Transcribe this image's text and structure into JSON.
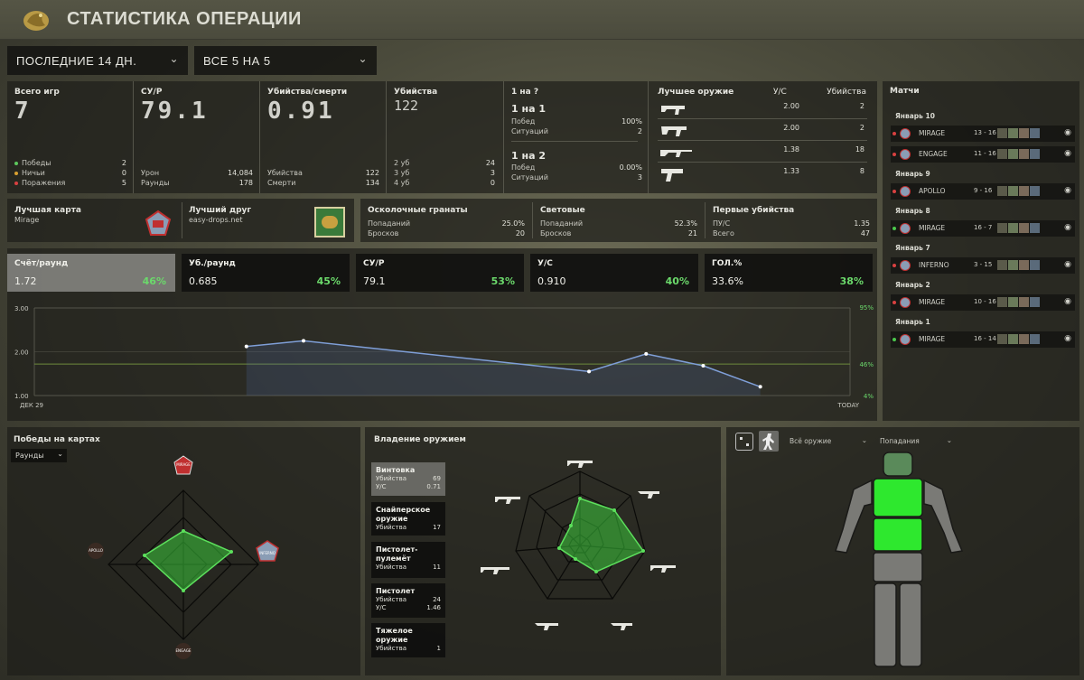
{
  "header": {
    "title": "СТАТИСТИКА ОПЕРАЦИИ"
  },
  "filters": {
    "period": "ПОСЛЕДНИЕ 14 ДН.",
    "mode": "ВСЕ 5 НА 5"
  },
  "summary": {
    "games": {
      "label": "Всего игр",
      "value": "7",
      "wins_label": "Победы",
      "wins": "2",
      "draws_label": "Ничьи",
      "draws": "0",
      "losses_label": "Поражения",
      "losses": "5"
    },
    "adr": {
      "label": "СУ/Р",
      "value": "79.1",
      "dmg_label": "Урон",
      "dmg": "14,084",
      "rounds_label": "Раунды",
      "rounds": "178"
    },
    "kd": {
      "label": "Убийства/смерти",
      "value": "0.91",
      "kills_label": "Убийства",
      "kills": "122",
      "deaths_label": "Смерти",
      "deaths": "134"
    },
    "kills": {
      "label": "Убийства",
      "value": "122",
      "r2_label": "2 уб",
      "r2": "24",
      "r3_label": "3 уб",
      "r3": "3",
      "r4_label": "4 уб",
      "r4": "0"
    },
    "clutch": {
      "title": "1 на ?",
      "c1": {
        "title": "1 на 1",
        "win_label": "Побед",
        "win": "100%",
        "sit_label": "Ситуаций",
        "sit": "2"
      },
      "c2": {
        "title": "1 на 2",
        "win_label": "Побед",
        "win": "0.00%",
        "sit_label": "Ситуаций",
        "sit": "3"
      }
    },
    "best_weapon": {
      "label": "Лучшее оружие",
      "col1": "У/С",
      "col2": "Убийства",
      "rows": [
        {
          "kd": "2.00",
          "kills": "2"
        },
        {
          "kd": "2.00",
          "kills": "2"
        },
        {
          "kd": "1.38",
          "kills": "18"
        },
        {
          "kd": "1.33",
          "kills": "8"
        }
      ]
    }
  },
  "second_row": {
    "best_map": {
      "label": "Лучшая карта",
      "value": "Mirage"
    },
    "best_friend": {
      "label": "Лучший друг",
      "value": "easy-drops.net"
    },
    "grenades": {
      "label": "Осколочные гранаты",
      "hit_label": "Попаданий",
      "hit": "25.0%",
      "throw_label": "Бросков",
      "throw": "20"
    },
    "flash": {
      "label": "Световые",
      "hit_label": "Попаданий",
      "hit": "52.3%",
      "throw_label": "Бросков",
      "throw": "21"
    },
    "first_kills": {
      "label": "Первые убийства",
      "kd_label": "ПУ/С",
      "kd": "1.35",
      "total_label": "Всего",
      "total": "47"
    }
  },
  "trend_tabs": [
    {
      "title": "Счёт/раунд",
      "value": "1.72",
      "pct": "46%"
    },
    {
      "title": "Уб./раунд",
      "value": "0.685",
      "pct": "45%"
    },
    {
      "title": "СУ/Р",
      "value": "79.1",
      "pct": "53%"
    },
    {
      "title": "У/С",
      "value": "0.910",
      "pct": "40%"
    },
    {
      "title": "ГОЛ.%",
      "value": "33.6%",
      "pct": "38%"
    }
  ],
  "chart_data": {
    "type": "line",
    "x_start_label": "ДЕК 29",
    "x_end_label": "TODAY",
    "y_left_ticks": [
      "3.00",
      "2.00",
      "1.00"
    ],
    "y_right_ticks": [
      "95%",
      "46%",
      "4%"
    ],
    "ylim": [
      1.0,
      3.0
    ],
    "average": 1.72,
    "series": [
      {
        "values": [
          2.12,
          2.25,
          1.55,
          1.95,
          1.68,
          1.2
        ]
      }
    ],
    "x_positions": [
      0.26,
      0.33,
      0.68,
      0.75,
      0.82,
      0.89
    ],
    "colors": {
      "line": "#7f9fd8",
      "avg": "#6e8a3c"
    }
  },
  "maps_panel": {
    "title": "Победы на картах",
    "dropdown": "Раунды",
    "labels": [
      "MIRAGE",
      "INFERNO",
      "APOLLO",
      "ENGAGE"
    ]
  },
  "weapons_panel": {
    "title": "Владение оружием",
    "cards": [
      {
        "name": "Винтовка",
        "r1l": "Убийства",
        "r1v": "69",
        "r2l": "У/С",
        "r2v": "0.71"
      },
      {
        "name": "Снайперское оружие",
        "r1l": "Убийства",
        "r1v": "17",
        "r2l": "",
        "r2v": ""
      },
      {
        "name": "Пистолет-пулемёт",
        "r1l": "Убийства",
        "r1v": "11",
        "r2l": "",
        "r2v": ""
      },
      {
        "name": "Пистолет",
        "r1l": "Убийства",
        "r1v": "24",
        "r2l": "У/С",
        "r2v": "1.46"
      },
      {
        "name": "Тяжелое оружие",
        "r1l": "Убийства",
        "r1v": "1",
        "r2l": "",
        "r2v": ""
      }
    ]
  },
  "body_panel": {
    "weapon_dd": "Всё оружие",
    "hits_dd": "Попадания"
  },
  "matches": {
    "title": "Матчи",
    "groups": [
      {
        "date": "Январь 10",
        "rows": [
          {
            "map": "MIRAGE",
            "score": "13 - 16",
            "result": "loss"
          },
          {
            "map": "ENGAGE",
            "score": "11 - 16",
            "result": "loss"
          }
        ]
      },
      {
        "date": "Январь 9",
        "rows": [
          {
            "map": "APOLLO",
            "score": "9 - 16",
            "result": "loss"
          }
        ]
      },
      {
        "date": "Январь 8",
        "rows": [
          {
            "map": "MIRAGE",
            "score": "16 - 7",
            "result": "win"
          }
        ]
      },
      {
        "date": "Январь 7",
        "rows": [
          {
            "map": "INFERNO",
            "score": "3 - 15",
            "result": "loss"
          }
        ]
      },
      {
        "date": "Январь 2",
        "rows": [
          {
            "map": "MIRAGE",
            "score": "10 - 16",
            "result": "loss"
          }
        ]
      },
      {
        "date": "Январь 1",
        "rows": [
          {
            "map": "MIRAGE",
            "score": "16 - 14",
            "result": "win"
          }
        ]
      }
    ]
  }
}
